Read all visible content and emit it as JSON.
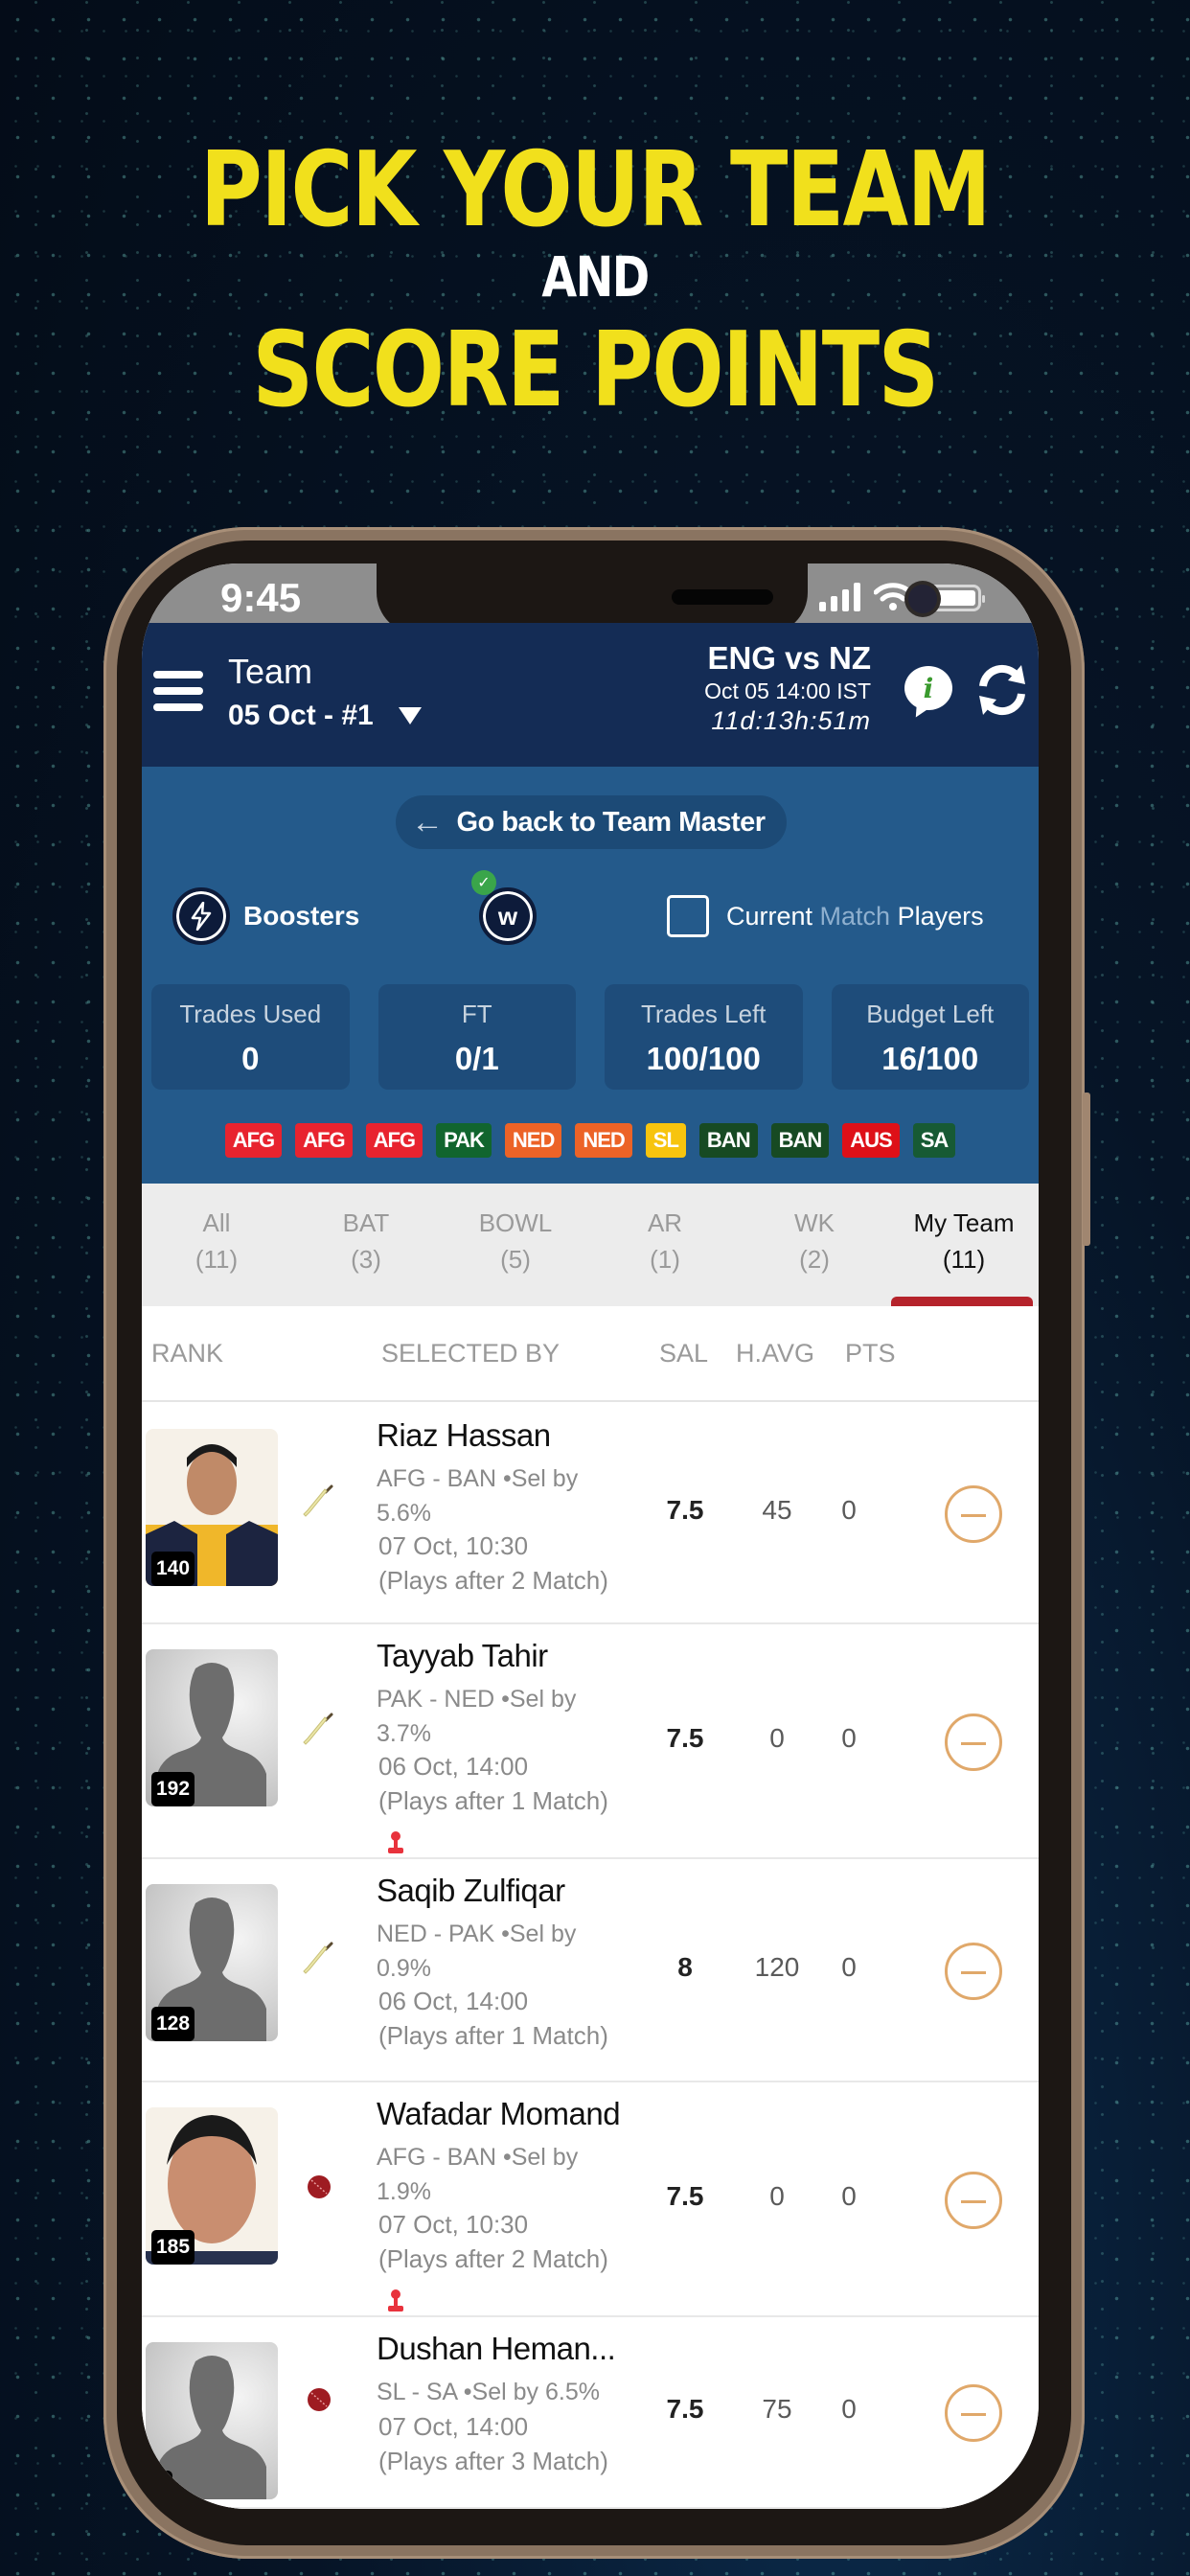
{
  "promo": {
    "line1": "PICK YOUR TEAM",
    "line2": "AND",
    "line3": "SCORE POINTS"
  },
  "status_bar": {
    "time": "9:45",
    "icons": [
      "signal-icon",
      "wifi-icon",
      "battery-icon"
    ]
  },
  "header": {
    "title": "Team",
    "team_selector": "05 Oct - #1",
    "match_name": "ENG vs NZ",
    "match_time": "Oct 05 14:00 IST",
    "countdown": "11d:13h:51m",
    "info_label": "i"
  },
  "panel": {
    "back_button": "Go back to Team Master",
    "boosters_label": "Boosters",
    "w_label": "w",
    "current_match": {
      "part1": "Current",
      "part2": "Match",
      "part3": "Players",
      "checked": false
    },
    "stats": [
      {
        "label": "Trades Used",
        "value": "0"
      },
      {
        "label": "FT",
        "value": "0/1"
      },
      {
        "label": "Trades Left",
        "value": "100/100"
      },
      {
        "label": "Budget Left",
        "value": "16/100"
      }
    ],
    "team_chips": [
      {
        "label": "AFG",
        "color": "#e8232f"
      },
      {
        "label": "AFG",
        "color": "#e8232f"
      },
      {
        "label": "AFG",
        "color": "#e8232f"
      },
      {
        "label": "PAK",
        "color": "#11652e"
      },
      {
        "label": "NED",
        "color": "#ec6327"
      },
      {
        "label": "NED",
        "color": "#ec6327"
      },
      {
        "label": "SL",
        "color": "#f7c40e"
      },
      {
        "label": "BAN",
        "color": "#174a23"
      },
      {
        "label": "BAN",
        "color": "#174a23"
      },
      {
        "label": "AUS",
        "color": "#de1018"
      },
      {
        "label": "SA",
        "color": "#175a34"
      }
    ]
  },
  "tabs": [
    {
      "label": "All",
      "count": "(11)",
      "active": false
    },
    {
      "label": "BAT",
      "count": "(3)",
      "active": false
    },
    {
      "label": "BOWL",
      "count": "(5)",
      "active": false
    },
    {
      "label": "AR",
      "count": "(1)",
      "active": false
    },
    {
      "label": "WK",
      "count": "(2)",
      "active": false
    },
    {
      "label": "My Team",
      "count": "(11)",
      "active": true
    }
  ],
  "columns": {
    "rank": "RANK",
    "selected_by": "SELECTED BY",
    "sal": "SAL",
    "havg": "H.AVG",
    "pts": "PTS"
  },
  "players": [
    {
      "name": "Riaz Hassan",
      "teams": "AFG - BAN •Sel by",
      "sel": "5.6%",
      "date": "07 Oct, 10:30",
      "plays_after": "(Plays after 2 Match)",
      "rank": "140",
      "role": "bat",
      "avatar": "photo",
      "sal": "7.5",
      "havg": "45",
      "pts": "0",
      "marker": false
    },
    {
      "name": "Tayyab Tahir",
      "teams": "PAK - NED •Sel by",
      "sel": "3.7%",
      "date": "06 Oct, 14:00",
      "plays_after": "(Plays after 1 Match)",
      "rank": "192",
      "role": "bat",
      "avatar": "placeholder",
      "sal": "7.5",
      "havg": "0",
      "pts": "0",
      "marker": true
    },
    {
      "name": "Saqib Zulfiqar",
      "teams": "NED - PAK •Sel by",
      "sel": "0.9%",
      "date": "06 Oct, 14:00",
      "plays_after": "(Plays after 1 Match)",
      "rank": "128",
      "role": "bat",
      "avatar": "placeholder",
      "sal": "8",
      "havg": "120",
      "pts": "0",
      "marker": false
    },
    {
      "name": "Wafadar Momand",
      "teams": "AFG - BAN •Sel by",
      "sel": "1.9%",
      "date": "07 Oct, 10:30",
      "plays_after": "(Plays after 2 Match)",
      "rank": "185",
      "role": "bowl",
      "avatar": "photo",
      "sal": "7.5",
      "havg": "0",
      "pts": "0",
      "marker": true
    },
    {
      "name": "Dushan Heman...",
      "teams": "SL - SA •Sel by 6.5%",
      "sel": "",
      "date": "07 Oct, 14:00",
      "plays_after": "(Plays after 3 Match)",
      "rank": "",
      "role": "bowl",
      "avatar": "placeholder",
      "sal": "7.5",
      "havg": "75",
      "pts": "0",
      "marker": false
    }
  ]
}
